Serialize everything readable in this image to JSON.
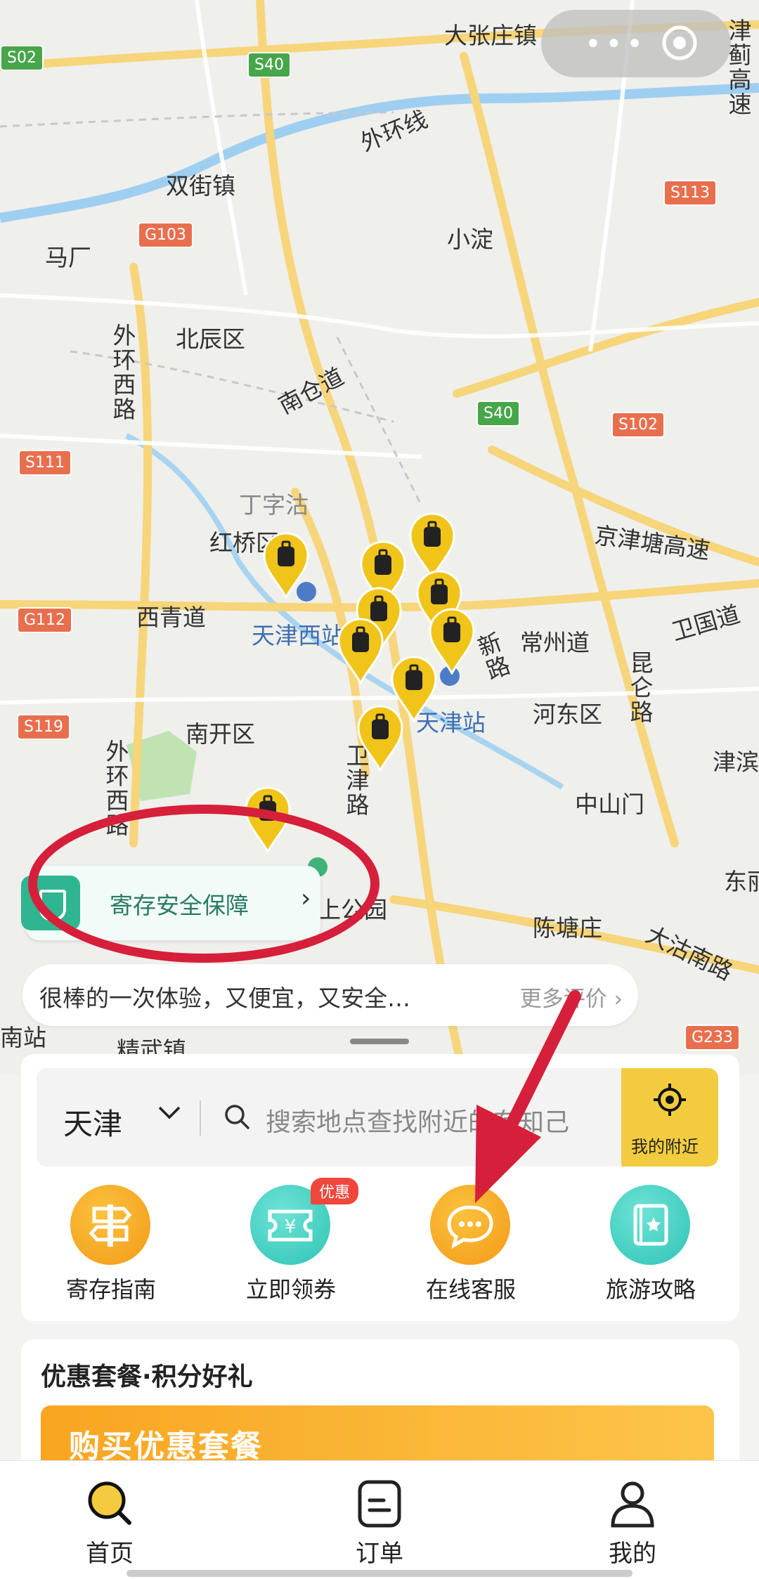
{
  "capsule": {
    "more_icon": "more-dots-icon",
    "close_icon": "target-close-icon"
  },
  "map": {
    "labels": [
      {
        "text": "大张庄镇",
        "style": "h"
      },
      {
        "text": "外环线",
        "style": "h"
      },
      {
        "text": "双街镇",
        "style": "h"
      },
      {
        "text": "小淀",
        "style": "h"
      },
      {
        "text": "马厂",
        "style": "h"
      },
      {
        "text": "北辰区",
        "style": "h"
      },
      {
        "text": "外环西路",
        "style": "v"
      },
      {
        "text": "南仓道",
        "style": "h"
      },
      {
        "text": "丁字沽",
        "style": "h"
      },
      {
        "text": "红桥区",
        "style": "h"
      },
      {
        "text": "西青道",
        "style": "h"
      },
      {
        "text": "天津西站",
        "style": "blue"
      },
      {
        "text": "京津塘高速",
        "style": "h"
      },
      {
        "text": "常州道",
        "style": "h"
      },
      {
        "text": "卫国道",
        "style": "h"
      },
      {
        "text": "河东区",
        "style": "h"
      },
      {
        "text": "天津站",
        "style": "blue"
      },
      {
        "text": "南开区",
        "style": "h"
      },
      {
        "text": "卫津路",
        "style": "v"
      },
      {
        "text": "中山门",
        "style": "h"
      },
      {
        "text": "外环西路",
        "style": "v"
      },
      {
        "text": "陈塘庄",
        "style": "h"
      },
      {
        "text": "大沽南路",
        "style": "h"
      },
      {
        "text": "精武镇",
        "style": "h"
      },
      {
        "text": "津蓟高速",
        "style": "v"
      },
      {
        "text": "昆仑路",
        "style": "v"
      },
      {
        "text": "津滨",
        "style": "h"
      },
      {
        "text": "东丽",
        "style": "h"
      },
      {
        "text": "新路",
        "style": "v"
      },
      {
        "text": "上公园",
        "style": "h"
      },
      {
        "text": "南站",
        "style": "h"
      }
    ],
    "shields": [
      {
        "text": "S40",
        "color": "green"
      },
      {
        "text": "G103",
        "color": "red"
      },
      {
        "text": "S113",
        "color": "red"
      },
      {
        "text": "S40",
        "color": "green"
      },
      {
        "text": "S102",
        "color": "red"
      },
      {
        "text": "S111",
        "color": "red"
      },
      {
        "text": "G112",
        "color": "red"
      },
      {
        "text": "S119",
        "color": "red"
      },
      {
        "text": "G233",
        "color": "red"
      },
      {
        "text": "S02",
        "color": "green"
      }
    ]
  },
  "safety": {
    "label": "寄存安全保障",
    "arrow": "›",
    "icon": "shield-icon"
  },
  "review": {
    "text": "很棒的一次体验，又便宜，又安全…",
    "more": "更多评价 ›"
  },
  "search": {
    "city": "天津",
    "placeholder": "搜索地点查找附近的存知己",
    "nearby_label": "我的附近"
  },
  "quick_actions": [
    {
      "label": "寄存指南",
      "icon": "signpost-icon",
      "color": "orange"
    },
    {
      "label": "立即领券",
      "icon": "coupon-icon",
      "color": "teal",
      "badge": "优惠"
    },
    {
      "label": "在线客服",
      "icon": "chat-icon",
      "color": "orange"
    },
    {
      "label": "旅游攻略",
      "icon": "guidebook-icon",
      "color": "teal"
    }
  ],
  "promo": {
    "title": "优惠套餐·积分好礼",
    "banner_text": "购买优惠套餐"
  },
  "tabs": [
    {
      "label": "首页",
      "icon": "search-home-icon",
      "active": true
    },
    {
      "label": "订单",
      "icon": "order-icon",
      "active": false
    },
    {
      "label": "我的",
      "icon": "profile-icon",
      "active": false
    }
  ],
  "colors": {
    "accent": "#f2cc3e",
    "teal": "#2ec4b6",
    "orange": "#f5a623",
    "annotation_red": "#d61f3a"
  }
}
